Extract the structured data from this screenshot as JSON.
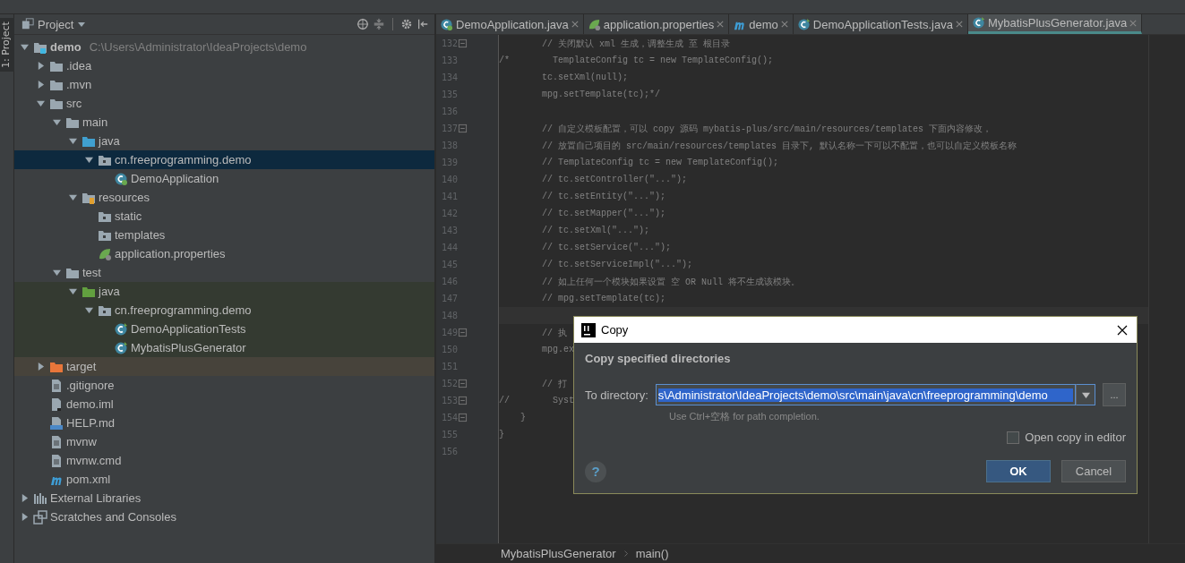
{
  "tool_strip": {
    "label": "1: Project"
  },
  "project_panel": {
    "title": "Project",
    "tree": [
      {
        "label": "demo",
        "path": "C:\\Users\\Administrator\\IdeaProjects\\demo",
        "kind": "module",
        "expanded": true,
        "selected": false,
        "children": [
          {
            "label": ".idea",
            "kind": "folder",
            "expanded": false,
            "selected": false
          },
          {
            "label": ".mvn",
            "kind": "folder",
            "expanded": false,
            "selected": false
          },
          {
            "label": "src",
            "kind": "folder",
            "expanded": true,
            "selected": false,
            "children": [
              {
                "label": "main",
                "kind": "folder",
                "expanded": true,
                "selected": false,
                "children": [
                  {
                    "label": "java",
                    "kind": "source-folder",
                    "expanded": true,
                    "selected": false,
                    "children": [
                      {
                        "label": "cn.freeprogramming.demo",
                        "kind": "package",
                        "expanded": true,
                        "selected": true,
                        "children": [
                          {
                            "label": "DemoApplication",
                            "kind": "spring-class",
                            "selected": false
                          }
                        ]
                      }
                    ]
                  },
                  {
                    "label": "resources",
                    "kind": "resources-folder",
                    "expanded": true,
                    "selected": false,
                    "children": [
                      {
                        "label": "static",
                        "kind": "package",
                        "selected": false
                      },
                      {
                        "label": "templates",
                        "kind": "package",
                        "selected": false
                      },
                      {
                        "label": "application.properties",
                        "kind": "spring-file",
                        "selected": false
                      }
                    ]
                  }
                ]
              },
              {
                "label": "test",
                "kind": "folder",
                "expanded": true,
                "selected": false,
                "children": [
                  {
                    "label": "java",
                    "kind": "test-folder",
                    "expanded": true,
                    "selected": false,
                    "color": "#343a31",
                    "children": [
                      {
                        "label": "cn.freeprogramming.demo",
                        "kind": "package",
                        "expanded": true,
                        "selected": false,
                        "color": "#343a31",
                        "children": [
                          {
                            "label": "DemoApplicationTests",
                            "kind": "class",
                            "selected": false,
                            "color": "#343a31"
                          },
                          {
                            "label": "MybatisPlusGenerator",
                            "kind": "class",
                            "selected": false,
                            "color": "#343a31"
                          }
                        ]
                      }
                    ]
                  }
                ]
              }
            ]
          },
          {
            "label": "target",
            "kind": "excluded-folder",
            "expanded": false,
            "selected": false,
            "color": "#47433b"
          },
          {
            "label": ".gitignore",
            "kind": "text-file",
            "selected": false
          },
          {
            "label": "demo.iml",
            "kind": "module-file",
            "selected": false
          },
          {
            "label": "HELP.md",
            "kind": "markdown-file",
            "selected": false
          },
          {
            "label": "mvnw",
            "kind": "text-file",
            "selected": false
          },
          {
            "label": "mvnw.cmd",
            "kind": "text-file",
            "selected": false
          },
          {
            "label": "pom.xml",
            "kind": "maven-file",
            "selected": false
          }
        ]
      },
      {
        "label": "External Libraries",
        "kind": "libraries",
        "expanded": false,
        "selected": false
      },
      {
        "label": "Scratches and Consoles",
        "kind": "scratches",
        "expanded": false,
        "selected": false
      }
    ]
  },
  "editor_tabs": [
    {
      "label": "DemoApplication.java",
      "kind": "spring-class",
      "selected": false
    },
    {
      "label": "application.properties",
      "kind": "spring-file",
      "selected": false
    },
    {
      "label": "demo",
      "kind": "maven-file",
      "selected": false
    },
    {
      "label": "DemoApplicationTests.java",
      "kind": "class",
      "selected": false
    },
    {
      "label": "MybatisPlusGenerator.java",
      "kind": "class",
      "selected": true
    }
  ],
  "code_lines": [
    {
      "number": "132",
      "text": "        // 关闭默认 xml 生成，调整生成 至 根目录",
      "fold": true,
      "current": false
    },
    {
      "number": "133",
      "text": "/*        TemplateConfig tc = new TemplateConfig();",
      "fold": false,
      "current": false
    },
    {
      "number": "134",
      "text": "        tc.setXml(null);",
      "fold": false,
      "current": false
    },
    {
      "number": "135",
      "text": "        mpg.setTemplate(tc);*/",
      "fold": false,
      "current": false
    },
    {
      "number": "136",
      "fold": false,
      "current": false
    },
    {
      "number": "137",
      "text": "        // 自定义模板配置，可以 copy 源码 mybatis-plus/src/main/resources/templates 下面内容修改，",
      "fold": true,
      "current": false
    },
    {
      "number": "138",
      "text": "        // 放置自己项目的 src/main/resources/templates 目录下, 默认名称一下可以不配置，也可以自定义模板名称",
      "fold": false,
      "current": false
    },
    {
      "number": "139",
      "text": "        // TemplateConfig tc = new TemplateConfig();",
      "fold": false,
      "current": false
    },
    {
      "number": "140",
      "text": "        // tc.setController(\"...\");",
      "fold": false,
      "current": false
    },
    {
      "number": "141",
      "text": "        // tc.setEntity(\"...\");",
      "fold": false,
      "current": false
    },
    {
      "number": "142",
      "text": "        // tc.setMapper(\"...\");",
      "fold": false,
      "current": false
    },
    {
      "number": "143",
      "text": "        // tc.setXml(\"...\");",
      "fold": false,
      "current": false
    },
    {
      "number": "144",
      "text": "        // tc.setService(\"...\");",
      "fold": false,
      "current": false
    },
    {
      "number": "145",
      "text": "        // tc.setServiceImpl(\"...\");",
      "fold": false,
      "current": false
    },
    {
      "number": "146",
      "text": "        // 如上任何一个模块如果设置 空 OR Null 将不生成该模块。",
      "fold": false,
      "current": false
    },
    {
      "number": "147",
      "text": "        // mpg.setTemplate(tc);",
      "fold": false,
      "current": false
    },
    {
      "number": "148",
      "fold": false,
      "current": true
    },
    {
      "number": "149",
      "text": "        // 执",
      "fold": true,
      "current": false
    },
    {
      "number": "150",
      "text": "        mpg.ex",
      "fold": false,
      "current": false
    },
    {
      "number": "151",
      "fold": false,
      "current": false
    },
    {
      "number": "152",
      "text": "        // 打",
      "fold": true,
      "current": false
    },
    {
      "number": "153",
      "text": "//        Syst",
      "fold": true,
      "current": false
    },
    {
      "number": "154",
      "text": "    }",
      "fold": true,
      "current": false
    },
    {
      "number": "155",
      "text": "}",
      "fold": false,
      "current": false
    },
    {
      "number": "156",
      "fold": false,
      "current": false
    }
  ],
  "breadcrumbs": [
    "MybatisPlusGenerator",
    "main()"
  ],
  "dialog": {
    "title": "Copy",
    "heading": "Copy specified directories",
    "field_label": "To directory:",
    "field_value": "s\\Administrator\\IdeaProjects\\demo\\src\\main\\java\\cn\\freeprogramming\\demo",
    "browse_button": "...",
    "hint": "Use Ctrl+空格 for path completion.",
    "checkbox": {
      "label": "Open copy in editor",
      "checked": false
    },
    "help": "?",
    "buttons": [
      {
        "label": "OK",
        "default": true
      },
      {
        "label": "Cancel",
        "default": false
      }
    ]
  }
}
